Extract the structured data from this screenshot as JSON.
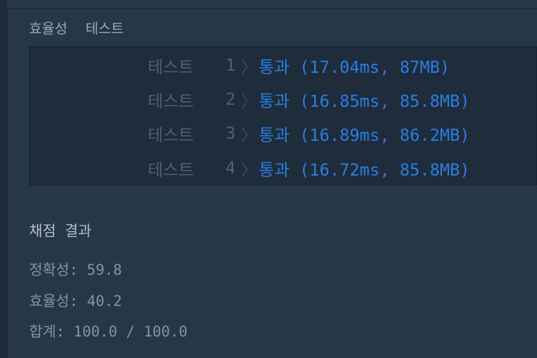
{
  "header": {
    "tab_efficiency": "효율성",
    "tab_test": "테스트"
  },
  "tests": [
    {
      "label": "테스트",
      "num": "1",
      "result": "통과 (17.04ms, 87MB)"
    },
    {
      "label": "테스트",
      "num": "2",
      "result": "통과 (16.85ms, 85.8MB)"
    },
    {
      "label": "테스트",
      "num": "3",
      "result": "통과 (16.89ms, 86.2MB)"
    },
    {
      "label": "테스트",
      "num": "4",
      "result": "통과 (16.72ms, 85.8MB)"
    }
  ],
  "grading": {
    "title": "채점 결과",
    "accuracy": "정확성: 59.8",
    "efficiency": "효율성: 40.2",
    "total": "합계: 100.0 / 100.0"
  },
  "colors": {
    "background": "#263747",
    "panel": "#1e2c3b",
    "pass_blue": "#2b7de0",
    "label_gray": "#4f6071"
  }
}
